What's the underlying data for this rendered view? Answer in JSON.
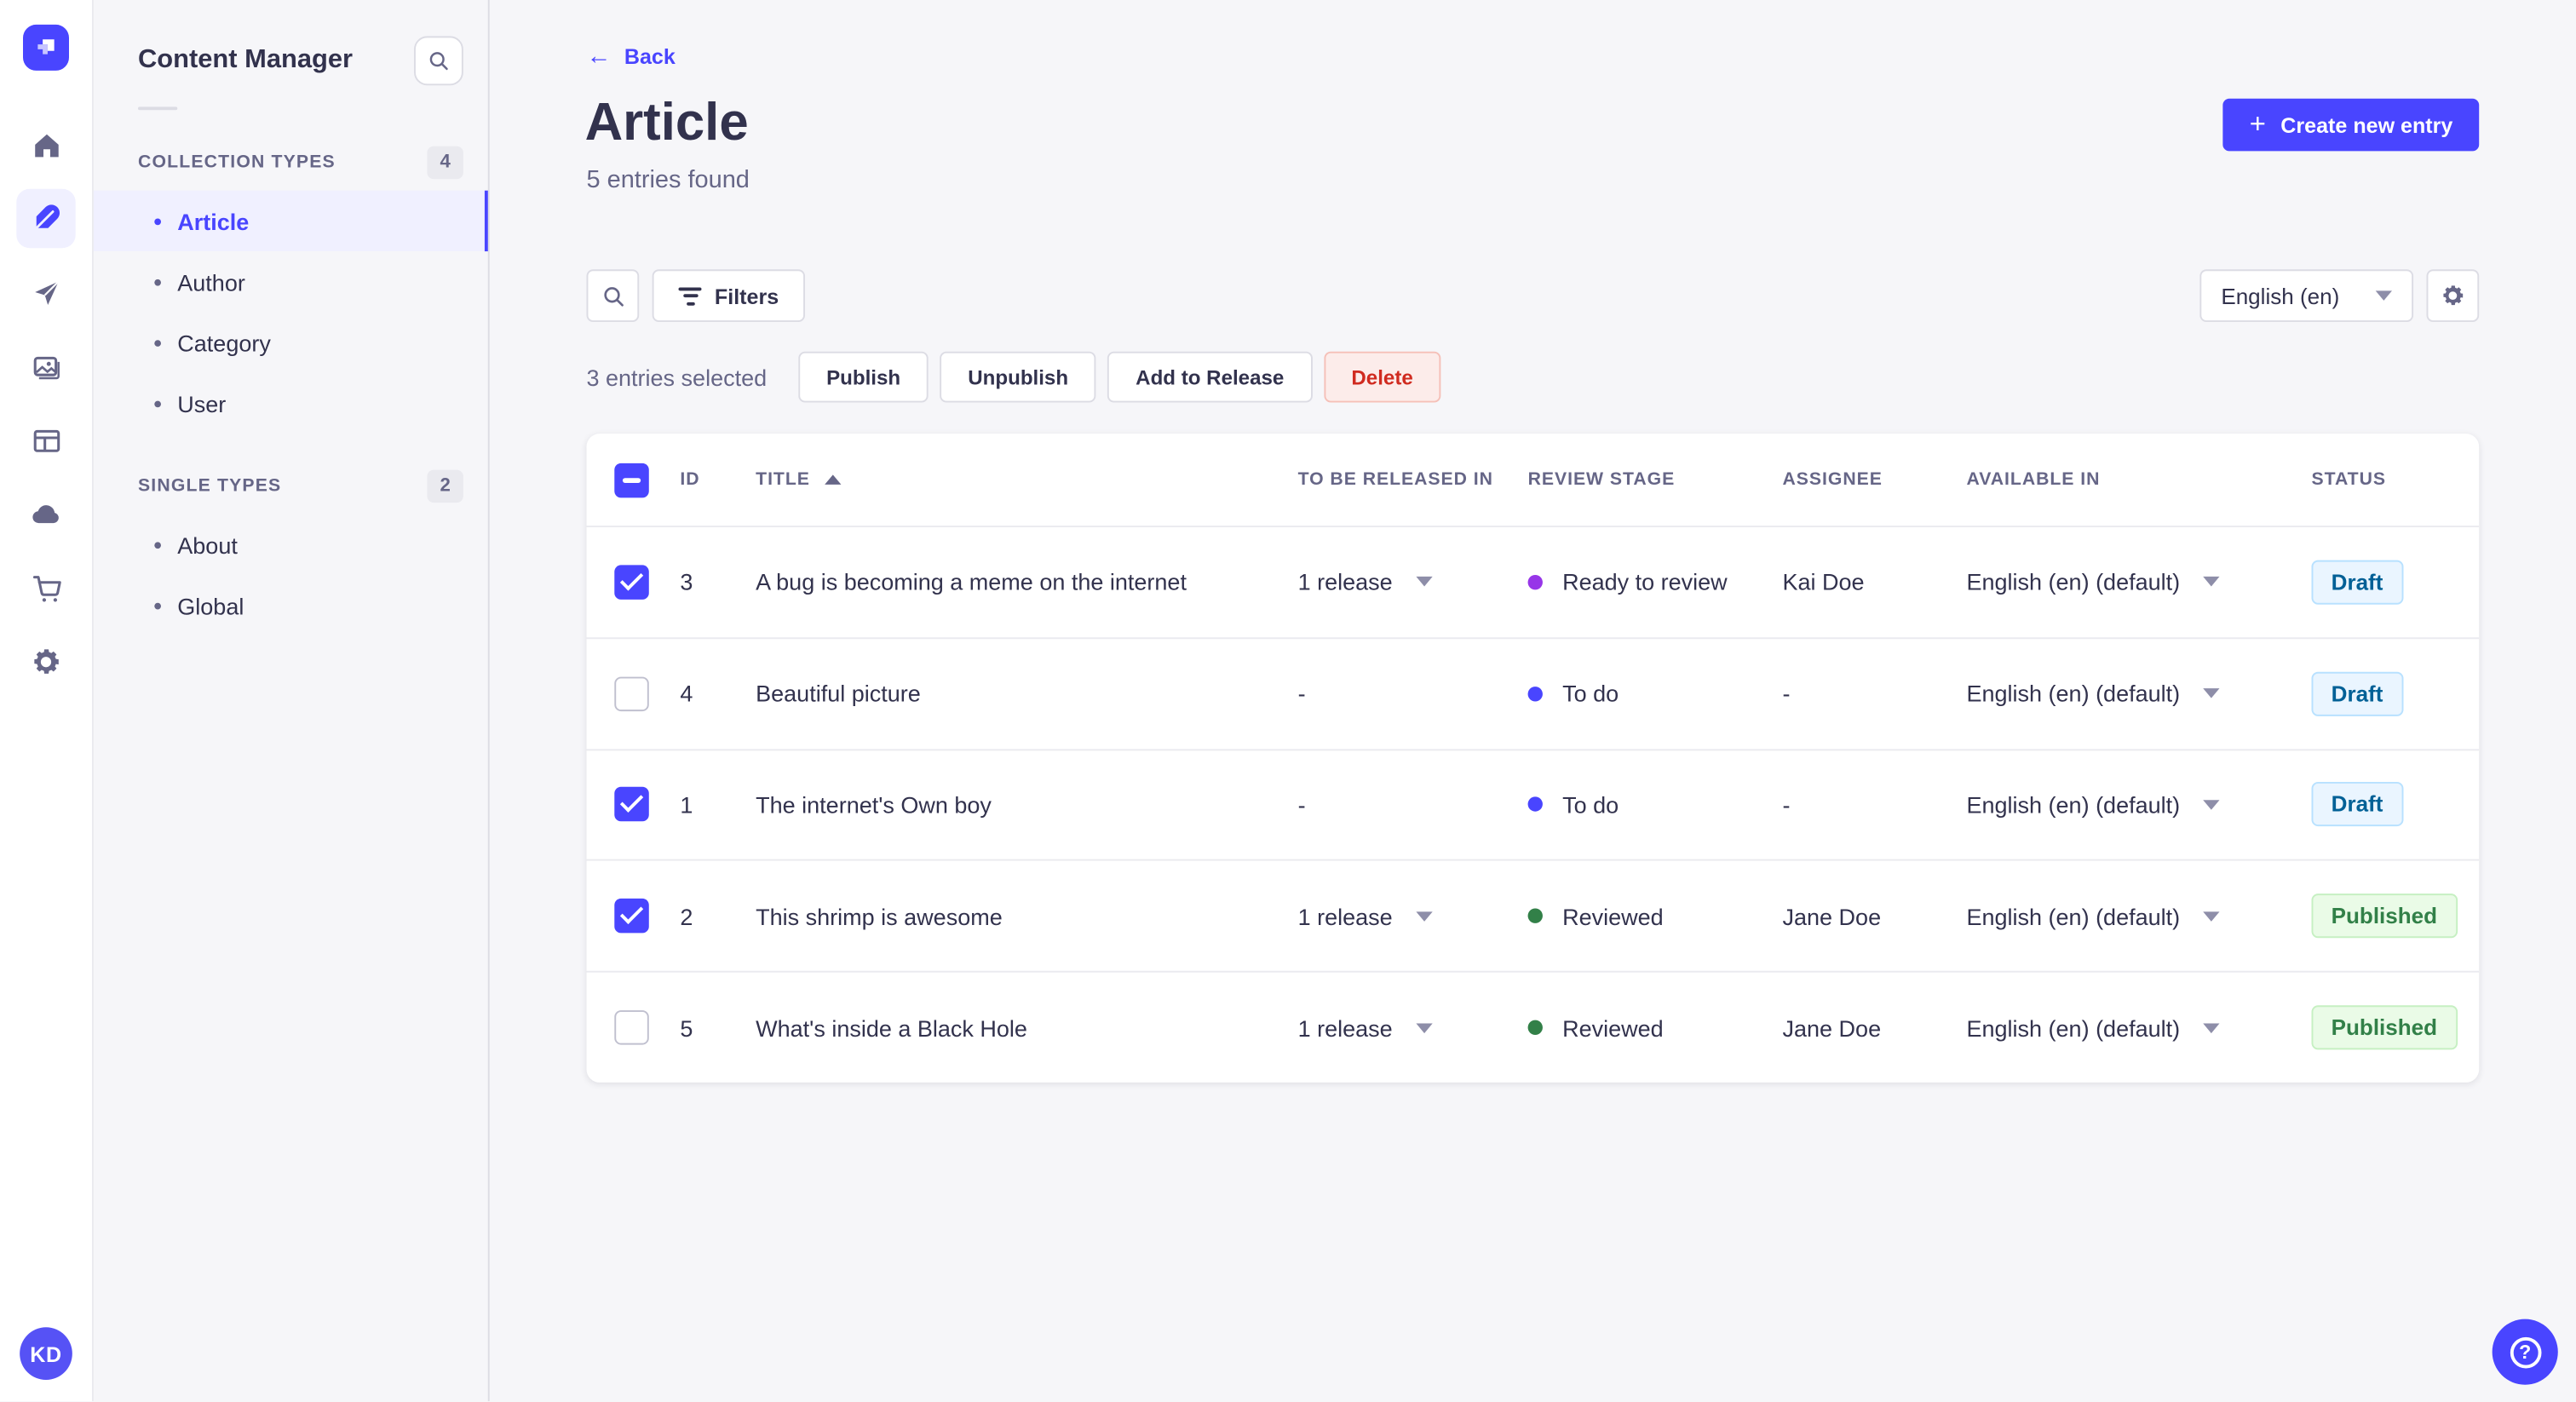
{
  "palette": {
    "primary": "#4945ff",
    "purple": "#9736e8",
    "blue": "#4945ff",
    "green": "#328048"
  },
  "subnav": {
    "title": "Content Manager",
    "sections": [
      {
        "label": "COLLECTION TYPES",
        "count": "4",
        "items": [
          {
            "label": "Article"
          },
          {
            "label": "Author"
          },
          {
            "label": "Category"
          },
          {
            "label": "User"
          }
        ]
      },
      {
        "label": "SINGLE TYPES",
        "count": "2",
        "items": [
          {
            "label": "About"
          },
          {
            "label": "Global"
          }
        ]
      }
    ]
  },
  "header": {
    "back": "Back",
    "title": "Article",
    "subtitle": "5 entries found",
    "create_button": "Create new entry"
  },
  "toolbar": {
    "filters": "Filters",
    "locale": "English (en)"
  },
  "selection": {
    "count_text": "3 entries selected",
    "publish": "Publish",
    "unpublish": "Unpublish",
    "add_to_release": "Add to Release",
    "delete": "Delete"
  },
  "table": {
    "headers": {
      "id": "ID",
      "title": "TITLE",
      "released": "TO BE RELEASED IN",
      "review": "REVIEW STAGE",
      "assignee": "ASSIGNEE",
      "available": "AVAILABLE IN",
      "status": "STATUS"
    },
    "rows": [
      {
        "checked": true,
        "id": "3",
        "title": "A bug is becoming a meme on the internet",
        "released": "1 release",
        "release_caret": true,
        "stage": "Ready to review",
        "stage_color": "purple",
        "assignee": "Kai Doe",
        "available": "English (en) (default)",
        "status": "Draft",
        "status_variant": "draft"
      },
      {
        "checked": false,
        "id": "4",
        "title": "Beautiful picture",
        "released": "-",
        "release_caret": false,
        "stage": "To do",
        "stage_color": "blue",
        "assignee": "-",
        "available": "English (en) (default)",
        "status": "Draft",
        "status_variant": "draft"
      },
      {
        "checked": true,
        "id": "1",
        "title": "The internet's Own boy",
        "released": "-",
        "release_caret": false,
        "stage": "To do",
        "stage_color": "blue",
        "assignee": "-",
        "available": "English (en) (default)",
        "status": "Draft",
        "status_variant": "draft"
      },
      {
        "checked": true,
        "id": "2",
        "title": "This shrimp is awesome",
        "released": "1 release",
        "release_caret": true,
        "stage": "Reviewed",
        "stage_color": "green",
        "assignee": "Jane Doe",
        "available": "English (en) (default)",
        "status": "Published",
        "status_variant": "published"
      },
      {
        "checked": false,
        "id": "5",
        "title": "What's inside a Black Hole",
        "released": "1 release",
        "release_caret": true,
        "stage": "Reviewed",
        "stage_color": "green",
        "assignee": "Jane Doe",
        "available": "English (en) (default)",
        "status": "Published",
        "status_variant": "published"
      }
    ]
  },
  "user": {
    "initials": "KD"
  }
}
